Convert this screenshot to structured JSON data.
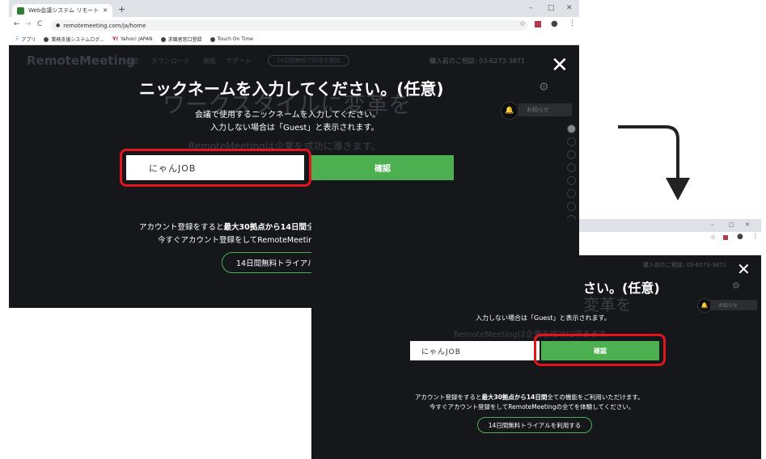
{
  "browser": {
    "tab_title": "Web会議システム リモートミーティング",
    "new_tab": "+",
    "url": "remotemeeting.com/ja/home",
    "bookmarks": [
      "アプリ",
      "業務支援システムログ...",
      "Yahoo! JAPAN",
      "求職者窓口登録",
      "Touch On Time"
    ],
    "window_controls": [
      "–",
      "□",
      "✕"
    ]
  },
  "site": {
    "logo": "RemoteMeeting",
    "nav": [
      "料金",
      "ダウンロード",
      "機能",
      "サポート"
    ],
    "trial_nav": "14日間無料で利用を開始",
    "contact": "購入前のご相談: 03-6273-3871",
    "hero": "ワークスタイルに変革を",
    "hero_sub": "RemoteMeetingは企業を成功に導きます。",
    "notice": "お知らせ"
  },
  "modal": {
    "title": "ニックネームを入力してください。(任意)",
    "line1": "会議で使用するニックネームを入力してください。",
    "line2": "入力しない場合は「Guest」と表示されます。",
    "nickname_value": "にゃんJOB",
    "confirm_label": "確認",
    "promo_pre": "アカウント登録をすると",
    "promo_bold": "最大30拠点から14日間",
    "promo_post": "全ての機能をご利用いただけます。",
    "promo_line2": "今すぐアカウント登録をしてRemoteMeetingの全てを体験してください。",
    "trial_button": "14日間無料トライアルを利用する",
    "close": "✕"
  },
  "second": {
    "title_fragment": "さい。(任意)",
    "hero_fragment": "変革を"
  },
  "colors": {
    "accent_green": "#4caf50",
    "highlight_red": "#e3141e"
  }
}
